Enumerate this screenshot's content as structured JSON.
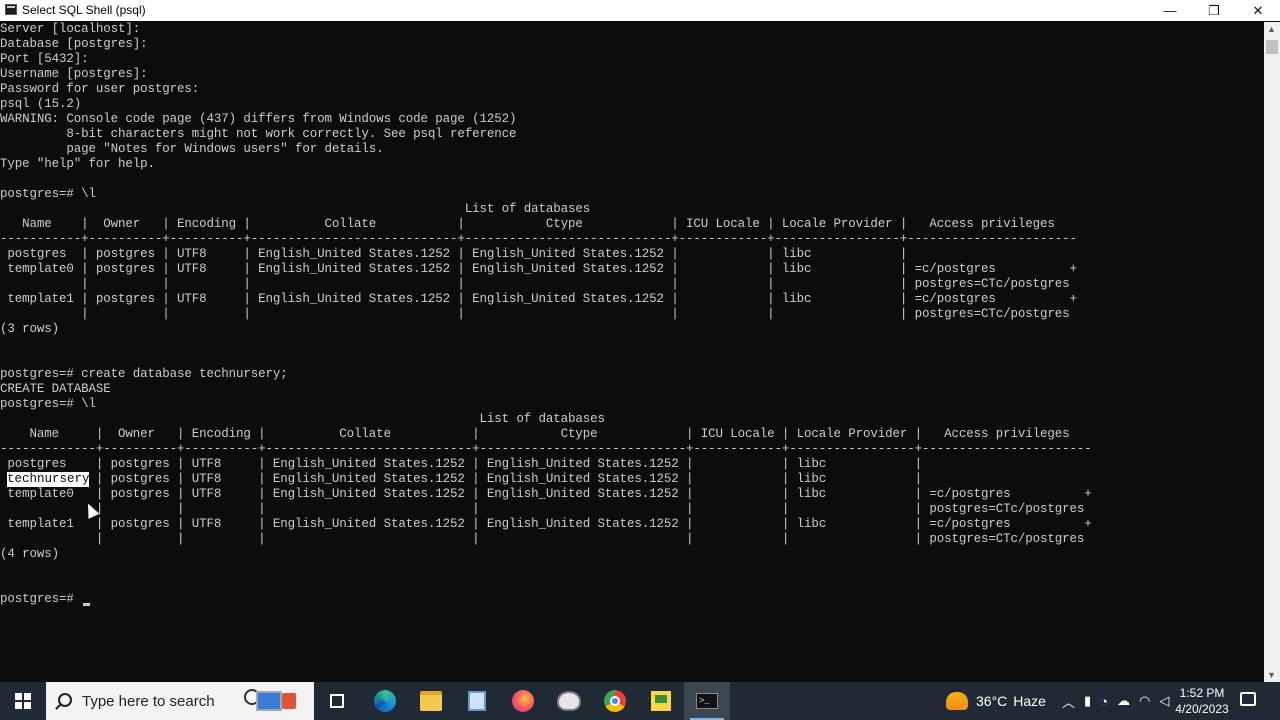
{
  "window": {
    "title": "Select SQL Shell (psql)",
    "minimize": "—",
    "maximize": "❐",
    "close": "✕"
  },
  "console": {
    "lines": [
      "Server [localhost]:",
      "Database [postgres]:",
      "Port [5432]:",
      "Username [postgres]:",
      "Password for user postgres:",
      "psql (15.2)",
      "WARNING: Console code page (437) differs from Windows code page (1252)",
      "         8-bit characters might not work correctly. See psql reference",
      "         page \"Notes for Windows users\" for details.",
      "Type \"help\" for help.",
      "",
      "postgres=# \\l",
      "                                                               List of databases",
      "   Name    |  Owner   | Encoding |          Collate           |           Ctype            | ICU Locale | Locale Provider |   Access privileges",
      "-----------+----------+----------+----------------------------+----------------------------+------------+-----------------+-----------------------",
      " postgres  | postgres | UTF8     | English_United States.1252 | English_United States.1252 |            | libc            |",
      " template0 | postgres | UTF8     | English_United States.1252 | English_United States.1252 |            | libc            | =c/postgres          +",
      "           |          |          |                            |                            |            |                 | postgres=CTc/postgres",
      " template1 | postgres | UTF8     | English_United States.1252 | English_United States.1252 |            | libc            | =c/postgres          +",
      "           |          |          |                            |                            |            |                 | postgres=CTc/postgres",
      "(3 rows)",
      "",
      "",
      "postgres=# create database technursery;",
      "CREATE DATABASE",
      "postgres=# \\l",
      "                                                                 List of databases",
      "    Name     |  Owner   | Encoding |          Collate           |           Ctype            | ICU Locale | Locale Provider |   Access privileges",
      "-------------+----------+----------+----------------------------+----------------------------+------------+-----------------+-----------------------",
      " postgres    | postgres | UTF8     | English_United States.1252 | English_United States.1252 |            | libc            |",
      " technursery | postgres | UTF8     | English_United States.1252 | English_United States.1252 |            | libc            |",
      " template0   | postgres | UTF8     | English_United States.1252 | English_United States.1252 |            | libc            | =c/postgres          +",
      "             |          |          |                            |                            |            |                 | postgres=CTc/postgres",
      " template1   | postgres | UTF8     | English_United States.1252 | English_United States.1252 |            | libc            | =c/postgres          +",
      "             |          |          |                            |                            |            |                 | postgres=CTc/postgres",
      "(4 rows)",
      "",
      "",
      "postgres=# "
    ],
    "highlighted_text": "technursery"
  },
  "taskbar": {
    "search_placeholder": "Type here to search",
    "weather_temp": "36°C",
    "weather_desc": "Haze",
    "time": "1:52 PM",
    "date": "4/20/2023",
    "pinned": [
      {
        "name": "task-view-icon",
        "class": "ico-task",
        "active": false
      },
      {
        "name": "edge-icon",
        "class": "ico-edge",
        "active": false
      },
      {
        "name": "file-explorer-icon",
        "class": "ico-folder",
        "active": false
      },
      {
        "name": "app-window-icon",
        "class": "ico-blue",
        "active": false
      },
      {
        "name": "firefox-icon",
        "class": "ico-ff",
        "active": false
      },
      {
        "name": "pgadmin-icon",
        "class": "ico-pg",
        "active": false
      },
      {
        "name": "chrome-icon",
        "class": "ico-chrome",
        "active": false
      },
      {
        "name": "sticky-notes-icon",
        "class": "ico-sticky",
        "active": false
      },
      {
        "name": "sql-shell-icon",
        "class": "ico-cmd",
        "active": true
      }
    ]
  }
}
